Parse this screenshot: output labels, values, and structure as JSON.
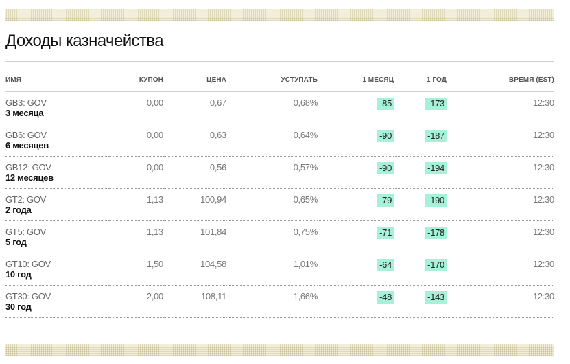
{
  "title": "Доходы казначейства",
  "columns": {
    "name": "ИМЯ",
    "coupon": "КУПОН",
    "price": "ЦЕНА",
    "yield": "УСТУПАТЬ",
    "month": "1 МЕСЯЦ",
    "year": "1 ГОД",
    "time": "ВРЕМЯ (EST)"
  },
  "rows": [
    {
      "ticker": "GB3: GOV",
      "maturity": "3 месяца",
      "coupon": "0,00",
      "price": "0,67",
      "yield": "0,68%",
      "month": "-85",
      "year": "-173",
      "time": "12:30"
    },
    {
      "ticker": "GB6: GOV",
      "maturity": "6 месяцев",
      "coupon": "0,00",
      "price": "0,63",
      "yield": "0,64%",
      "month": "-90",
      "year": "-187",
      "time": "12:30"
    },
    {
      "ticker": "GB12: GOV",
      "maturity": "12 месяцев",
      "coupon": "0,00",
      "price": "0,56",
      "yield": "0,57%",
      "month": "-90",
      "year": "-194",
      "time": "12:30"
    },
    {
      "ticker": "GT2: GOV",
      "maturity": "2 года",
      "coupon": "1,13",
      "price": "100,94",
      "yield": "0,65%",
      "month": "-79",
      "year": "-190",
      "time": "12:30"
    },
    {
      "ticker": "GT5: GOV",
      "maturity": "5 год",
      "coupon": "1,13",
      "price": "101,84",
      "yield": "0,75%",
      "month": "-71",
      "year": "-178",
      "time": "12:30"
    },
    {
      "ticker": "GT10: GOV",
      "maturity": "10 год",
      "coupon": "1,50",
      "price": "104,58",
      "yield": "1,01%",
      "month": "-64",
      "year": "-170",
      "time": "12:30"
    },
    {
      "ticker": "GT30: GOV",
      "maturity": "30 год",
      "coupon": "2,00",
      "price": "108,11",
      "yield": "1,66%",
      "month": "-48",
      "year": "-143",
      "time": "12:30"
    }
  ],
  "colors": {
    "change_highlight": "#a6f1d8",
    "band": "#f3f0dc"
  }
}
